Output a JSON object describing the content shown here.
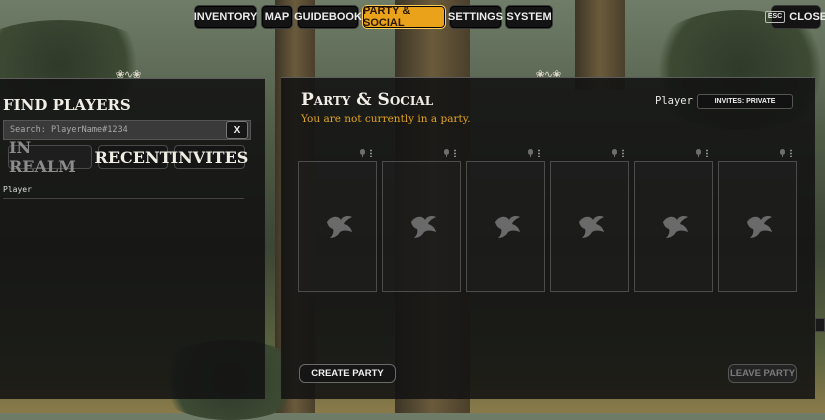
{
  "nav": {
    "tabs": [
      {
        "label": "INVENTORY",
        "active": false
      },
      {
        "label": "MAP",
        "active": false
      },
      {
        "label": "GUIDEBOOK",
        "active": false
      },
      {
        "label": "PARTY & SOCIAL",
        "active": true
      },
      {
        "label": "SETTINGS",
        "active": false
      },
      {
        "label": "SYSTEM",
        "active": false
      }
    ],
    "close_key": "ESC",
    "close_label": "CLOSE",
    "accent_color": "#e9a21a"
  },
  "find_players": {
    "title": "FIND PLAYERS",
    "search_placeholder": "Search: PlayerName#1234",
    "clear_label": "X",
    "filter_tabs": [
      "IN REALM",
      "RECENT",
      "INVITES"
    ],
    "players": [
      "Player"
    ]
  },
  "party": {
    "title": "Party & Social",
    "status": "You are not currently in a party.",
    "player_name": "Player",
    "invites_label": "INVITES: PRIVATE",
    "slot_count": 6,
    "slot_icon": "bird-emblem-icon",
    "create_label": "CREATE PARTY",
    "leave_label": "LEAVE PARTY"
  }
}
